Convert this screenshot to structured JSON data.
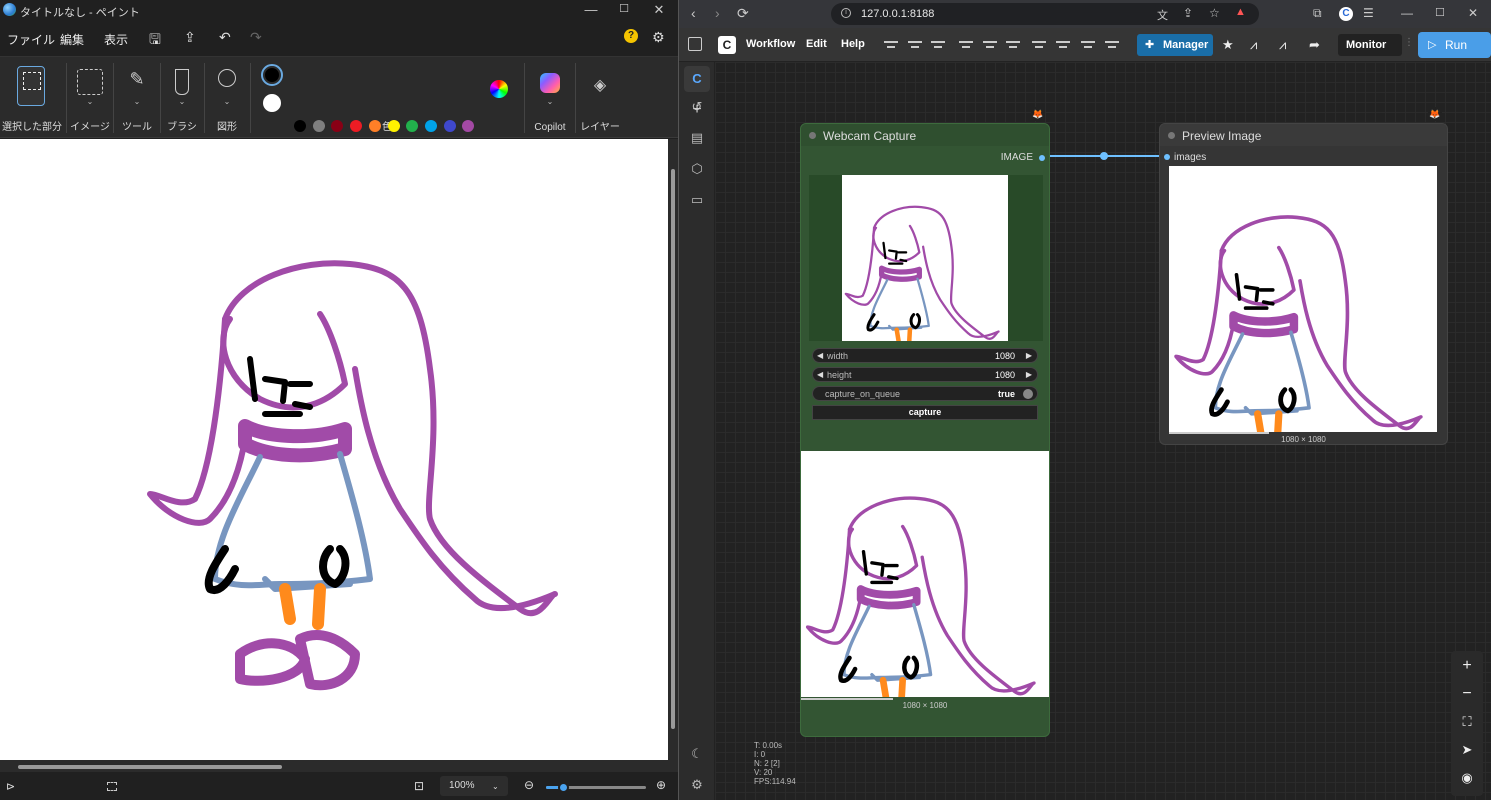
{
  "paint": {
    "title": "タイトルなし - ペイント",
    "menu": [
      "ファイル",
      "編集",
      "表示"
    ],
    "groups": {
      "select": "選択した部分",
      "image": "イメージ",
      "tools": "ツール",
      "brush": "ブラシ",
      "shapes": "図形",
      "colors": "色",
      "copilot": "Copilot",
      "layers": "レイヤー"
    },
    "palette_row1": [
      "#000000",
      "#7f7f7f",
      "#880015",
      "#ed1c24",
      "#ff7f27",
      "#fff200",
      "#22b14c",
      "#00a2e8",
      "#3f48cc",
      "#a349a4"
    ],
    "palette_row2": [
      "#ffffff",
      "#c3c3c3",
      "#b97a57",
      "#ffaec9",
      "#ffc90e",
      "#efe4b0",
      "#b5e61d",
      "#99d9ea",
      "#7092be",
      "#c8bfe7"
    ],
    "zoom": "100%",
    "zoom_level_percent": 17,
    "colors": {
      "hair": "#a14ba8",
      "body": "#7896c0",
      "legs": "#ff8a1c",
      "ink": "#000000"
    }
  },
  "browser": {
    "url": "127.0.0.1:8188"
  },
  "comfy": {
    "menu": {
      "workflow": "Workflow",
      "edit": "Edit",
      "help": "Help"
    },
    "manager": "Manager",
    "monitor": "Monitor",
    "run": "Run",
    "webcam": {
      "title": "Webcam Capture",
      "output": "IMAGE",
      "width_label": "width",
      "width": "1080",
      "height_label": "height",
      "height": "1080",
      "capture_label": "capture_on_queue",
      "capture_value": "true",
      "button": "capture",
      "dim": "1080 × 1080"
    },
    "preview": {
      "title": "Preview Image",
      "input": "images",
      "dim": "1080 × 1080"
    },
    "stats": [
      "T: 0.00s",
      "I: 0",
      "N: 2 [2]",
      "V: 20",
      "FPS:114.94"
    ]
  }
}
